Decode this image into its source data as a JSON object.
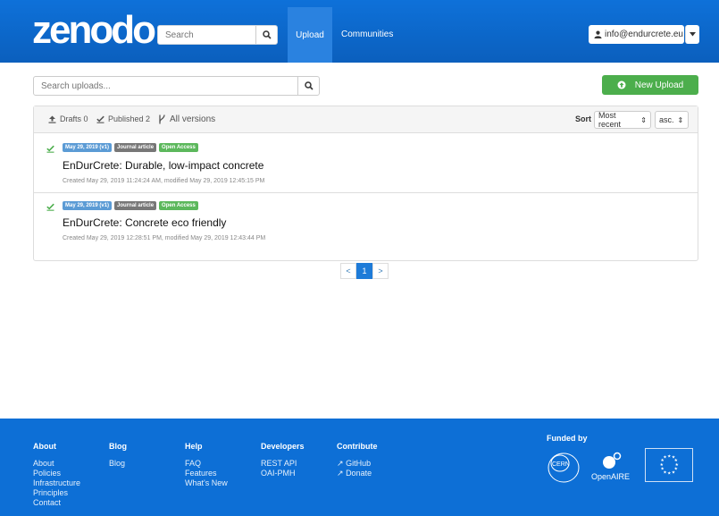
{
  "header": {
    "logo": "zenodo",
    "search_placeholder": "Search",
    "nav_upload": "Upload",
    "nav_communities": "Communities",
    "user_email": "info@endurcrete.eu"
  },
  "toolbar": {
    "search_placeholder": "Search uploads...",
    "new_upload_label": "New Upload"
  },
  "filters": {
    "drafts": "Drafts 0",
    "published": "Published 2",
    "versions": "All versions",
    "sort_label": "Sort",
    "sort_value": "Most recent",
    "order_value": "asc."
  },
  "records": [
    {
      "date_badge": "May 29, 2019 (v1)",
      "type_badge": "Journal article",
      "access_badge": "Open Access",
      "title": "EnDurCrete: Durable, low-impact concrete",
      "meta": "Created May 29, 2019 11:24:24 AM, modified May 29, 2019 12:45:15 PM"
    },
    {
      "date_badge": "May 29, 2019 (v1)",
      "type_badge": "Journal article",
      "access_badge": "Open Access",
      "title": "EnDurCrete: Concrete eco friendly",
      "meta": "Created May 29, 2019 12:28:51 PM, modified May 29, 2019 12:43:44 PM"
    }
  ],
  "pagination": {
    "prev": "<",
    "current": "1",
    "next": ">"
  },
  "footer": {
    "about": {
      "heading": "About",
      "links": [
        "About",
        "Policies",
        "Infrastructure",
        "Principles",
        "Contact"
      ]
    },
    "blog": {
      "heading": "Blog",
      "links": [
        "Blog"
      ]
    },
    "help": {
      "heading": "Help",
      "links": [
        "FAQ",
        "Features",
        "What's New"
      ]
    },
    "developers": {
      "heading": "Developers",
      "links": [
        "REST API",
        "OAI-PMH"
      ]
    },
    "contribute": {
      "heading": "Contribute",
      "links": [
        "GitHub",
        "Donate"
      ]
    },
    "funded_by": "Funded by",
    "cern": "CERN",
    "openaire": "OpenAIRE"
  },
  "colors": {
    "brand_blue": "#0b63c8",
    "success_green": "#4cae4c"
  }
}
